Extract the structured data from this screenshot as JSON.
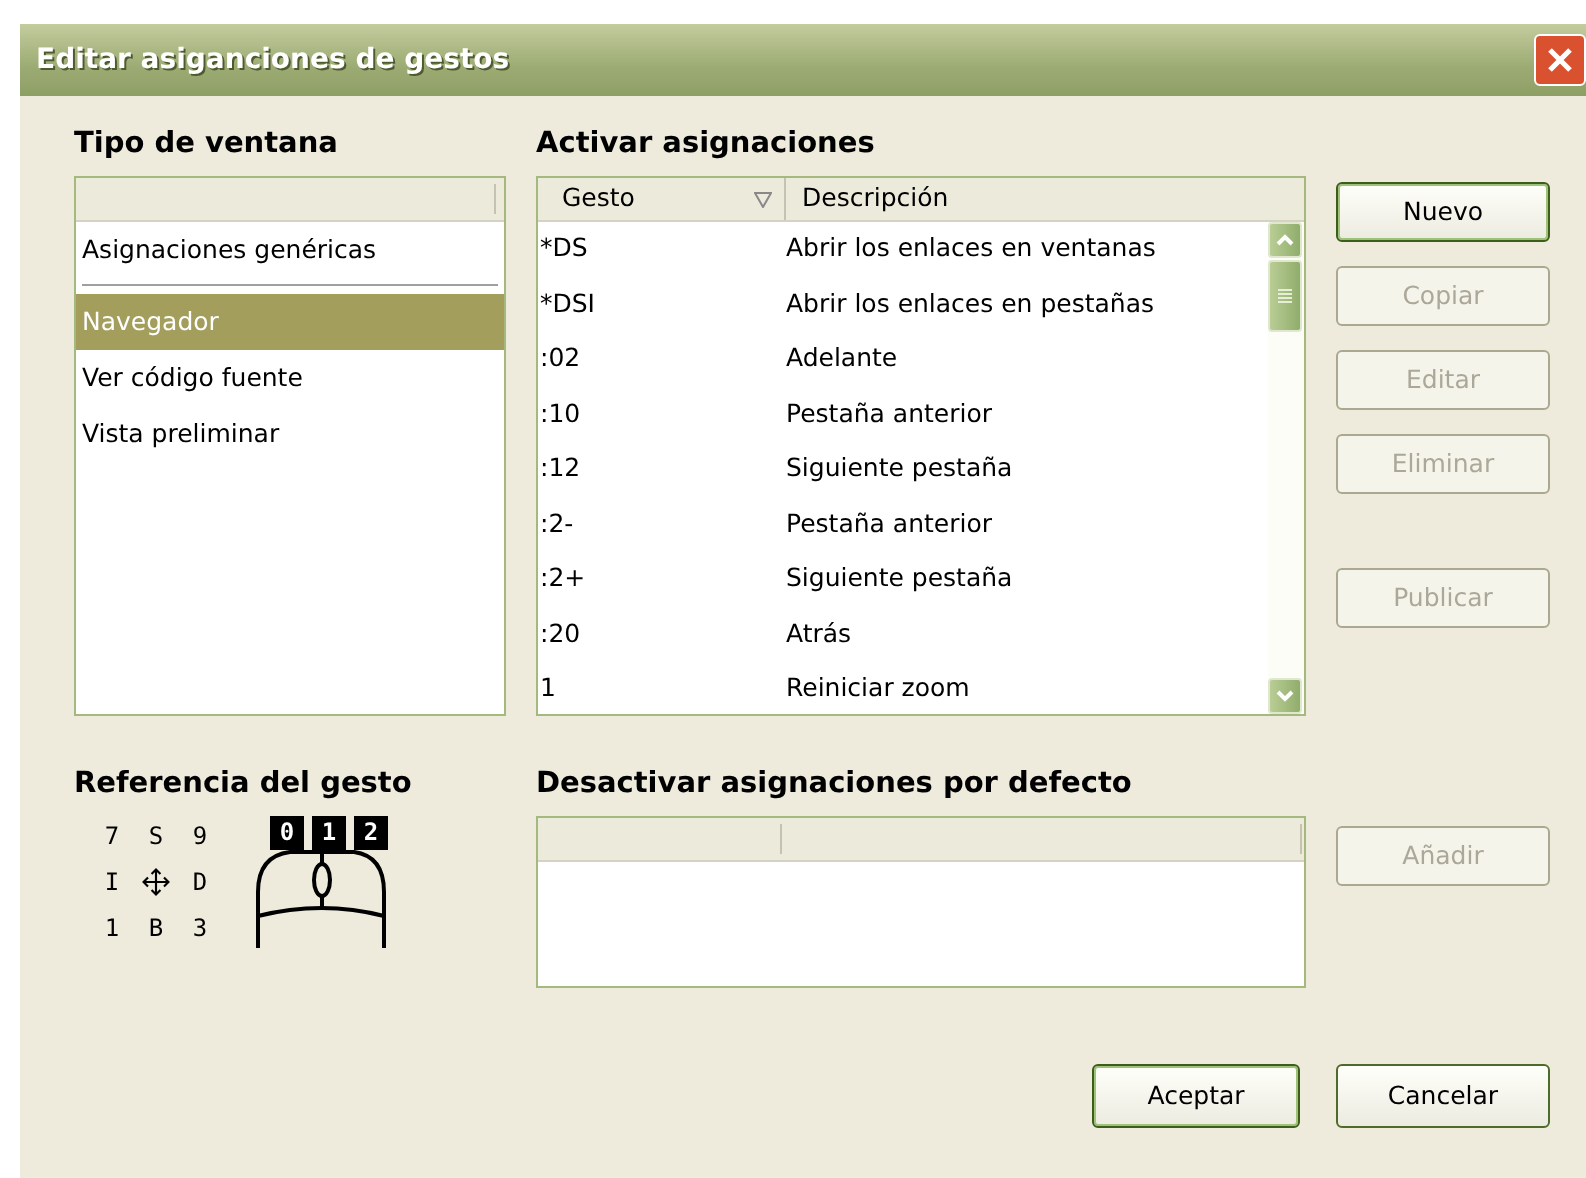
{
  "window": {
    "title": "Editar asiganciones de gestos"
  },
  "window_types": {
    "heading": "Tipo de ventana",
    "items": [
      {
        "label": "Asignaciones genéricas",
        "selected": false,
        "separator_after": true
      },
      {
        "label": "Navegador",
        "selected": true,
        "separator_after": false
      },
      {
        "label": "Ver código fuente",
        "selected": false,
        "separator_after": false
      },
      {
        "label": "Vista preliminar",
        "selected": false,
        "separator_after": false
      }
    ]
  },
  "assignments": {
    "heading": "Activar asignaciones",
    "columns": [
      {
        "label": "Gesto",
        "sorted": true
      },
      {
        "label": "Descripción",
        "sorted": false
      }
    ],
    "rows": [
      {
        "gesture": "*DS",
        "description": "Abrir los enlaces en ventanas"
      },
      {
        "gesture": "*DSI",
        "description": "Abrir los enlaces en pestañas"
      },
      {
        "gesture": ":02",
        "description": "Adelante"
      },
      {
        "gesture": ":10",
        "description": "Pestaña anterior"
      },
      {
        "gesture": ":12",
        "description": "Siguiente pestaña"
      },
      {
        "gesture": ":2-",
        "description": "Pestaña anterior"
      },
      {
        "gesture": ":2+",
        "description": "Siguiente pestaña"
      },
      {
        "gesture": ":20",
        "description": "Atrás"
      },
      {
        "gesture": "1",
        "description": "Reiniciar zoom"
      }
    ]
  },
  "side_button_groups": [
    {
      "buttons": [
        {
          "label": "Nuevo",
          "disabled": false,
          "default": true
        },
        {
          "label": "Copiar",
          "disabled": true,
          "default": false
        },
        {
          "label": "Editar",
          "disabled": true,
          "default": false
        },
        {
          "label": "Eliminar",
          "disabled": true,
          "default": false
        }
      ]
    },
    {
      "buttons": [
        {
          "label": "Publicar",
          "disabled": true,
          "default": false
        }
      ]
    }
  ],
  "gesture_reference": {
    "heading": "Referencia del gesto",
    "keys": [
      {
        "kind": "text",
        "text": "7"
      },
      {
        "kind": "text",
        "text": "S"
      },
      {
        "kind": "text",
        "text": "9"
      },
      {
        "kind": "text",
        "text": "I"
      },
      {
        "kind": "icon"
      },
      {
        "kind": "text",
        "text": "D"
      },
      {
        "kind": "text",
        "text": "1"
      },
      {
        "kind": "text",
        "text": "B"
      },
      {
        "kind": "text",
        "text": "3"
      }
    ],
    "mouse_buttons": [
      "0",
      "1",
      "2"
    ]
  },
  "disabled_defaults": {
    "heading": "Desactivar asignaciones por defecto",
    "button": {
      "label": "Añadir",
      "disabled": true
    }
  },
  "footer_buttons": [
    {
      "label": "Aceptar",
      "disabled": false,
      "default": true
    },
    {
      "label": "Cancelar",
      "disabled": false,
      "default": false
    }
  ]
}
